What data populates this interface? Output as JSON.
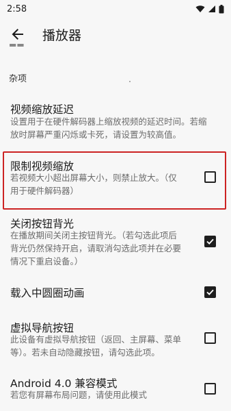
{
  "status_bar": {
    "time": "2:58"
  },
  "app_bar": {
    "title": "播放器"
  },
  "section": {
    "title": "杂项"
  },
  "prefs": [
    {
      "title": "视频缩放延迟",
      "summary_lines": [
        "设置用于在硬件解码器上缩放视频的延迟时间。若缩",
        "放时屏幕严重闪烁或卡死，请设置为较高值。"
      ]
    },
    {
      "title": "限制视频缩放",
      "summary_lines": [
        "若视频大小超出屏幕大小，则禁止放大。（仅",
        "用于硬件解码器）"
      ],
      "checked": false
    },
    {
      "title": "关闭按钮背光",
      "summary_lines": [
        "在播放期间关闭主按钮背光。（若勾选此项后",
        "背光仍然保持开启，请取消勾选此项并在必要",
        "情况下重启设备。）"
      ],
      "checked": true
    },
    {
      "title": "载入中圆圈动画",
      "checked": true
    },
    {
      "title": "虚拟导航按钮",
      "summary_lines": [
        "此设备有虚拟导航按钮（返回、主屏幕、菜单",
        "等）。若未自动隐藏按钮，请勾选此项。"
      ],
      "checked": false
    },
    {
      "title": "Android 4.0 兼容模式",
      "summary_lines": [
        "若您有屏幕布局问题，请使用此模式"
      ],
      "checked": false
    }
  ],
  "icons": {
    "back": "arrow-back-icon",
    "wifi": "wifi-icon",
    "signal": "signal-icon",
    "battery": "battery-icon",
    "check": "checkmark-icon"
  },
  "colors": {
    "highlight": "#cc2222",
    "checkbox": "#1e1e1e"
  }
}
